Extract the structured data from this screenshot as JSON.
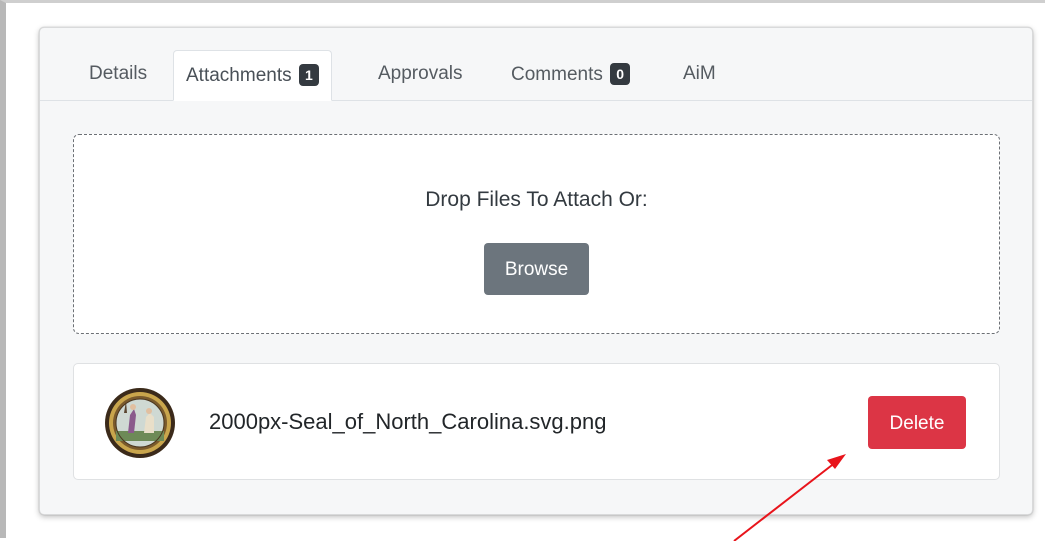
{
  "tabs": [
    {
      "label": "Details",
      "badge": null,
      "active": false
    },
    {
      "label": "Attachments",
      "badge": "1",
      "active": true
    },
    {
      "label": "Approvals",
      "badge": null,
      "active": false
    },
    {
      "label": "Comments",
      "badge": "0",
      "active": false
    },
    {
      "label": "AiM",
      "badge": null,
      "active": false
    }
  ],
  "dropzone": {
    "prompt": "Drop Files To Attach Or:",
    "browse_label": "Browse"
  },
  "attachment": {
    "file_name": "2000px-Seal_of_North_Carolina.svg.png",
    "thumbnail_icon": "state-seal-thumbnail",
    "delete_label": "Delete"
  },
  "annotation": {
    "arrow_color": "#e8141b"
  },
  "colors": {
    "danger": "#dc3545",
    "secondary": "#6c757d",
    "badge": "#343a40"
  }
}
